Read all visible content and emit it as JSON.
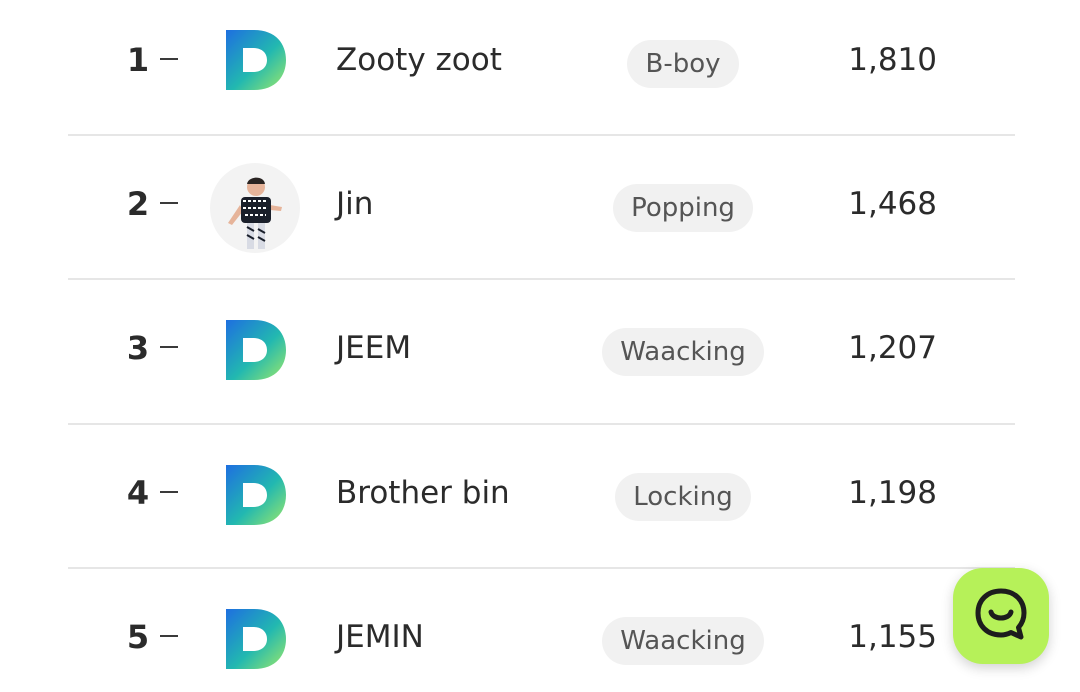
{
  "accent_colors": {
    "logo_gradient_start": "#1e6fe0",
    "logo_gradient_end": "#9be86a",
    "chat_button": "#b6f159"
  },
  "rankings": [
    {
      "rank": "1",
      "change_icon": "dash-icon",
      "avatar": "d-logo-icon",
      "name": "Zooty zoot",
      "genre": "B-boy",
      "score": "1,810"
    },
    {
      "rank": "2",
      "change_icon": "dash-icon",
      "avatar": "dancer-photo",
      "name": "Jin",
      "genre": "Popping",
      "score": "1,468"
    },
    {
      "rank": "3",
      "change_icon": "dash-icon",
      "avatar": "d-logo-icon",
      "name": "JEEM",
      "genre": "Waacking",
      "score": "1,207"
    },
    {
      "rank": "4",
      "change_icon": "dash-icon",
      "avatar": "d-logo-icon",
      "name": "Brother bin",
      "genre": "Locking",
      "score": "1,198"
    },
    {
      "rank": "5",
      "change_icon": "dash-icon",
      "avatar": "d-logo-icon",
      "name": "JEMIN",
      "genre": "Waacking",
      "score": "1,155"
    }
  ],
  "chat_button": {
    "icon": "chat-smile-icon"
  }
}
